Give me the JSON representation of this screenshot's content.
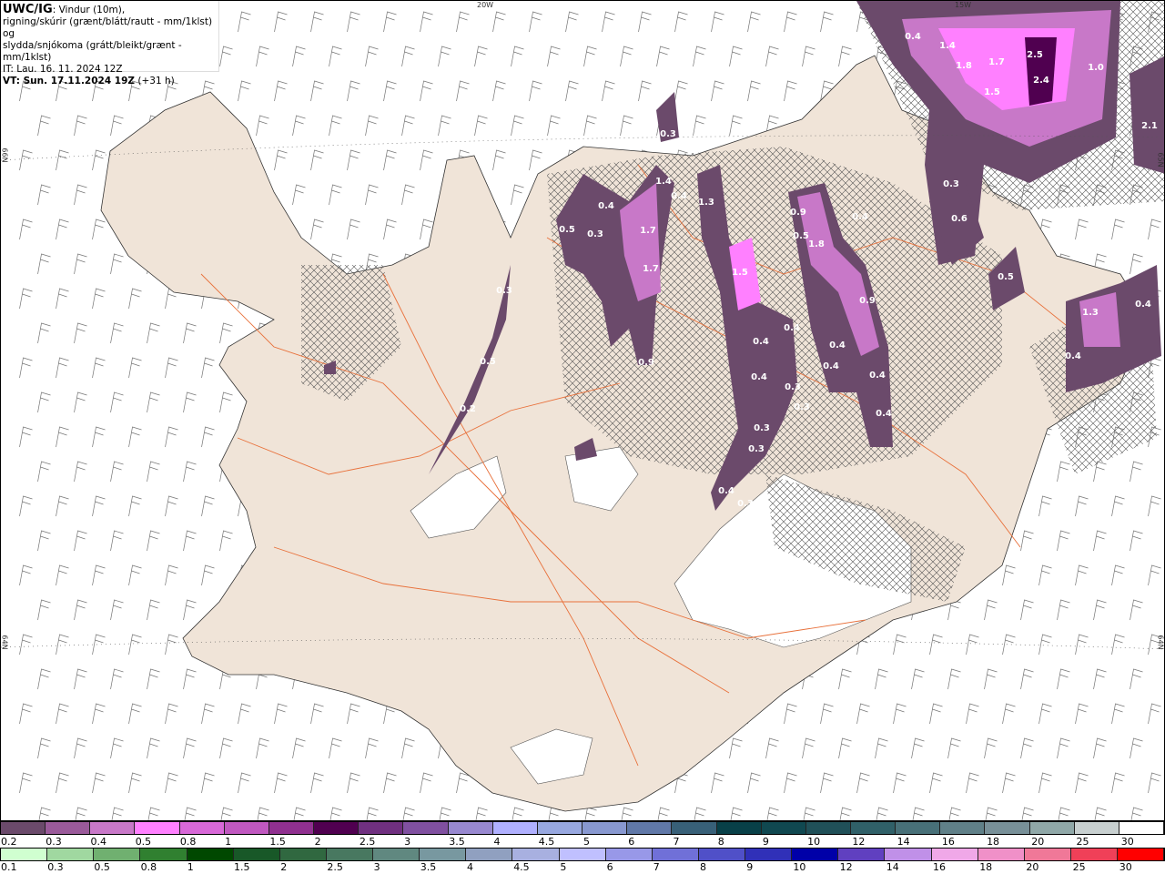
{
  "header": {
    "model": "UWC/IG",
    "title_rest": ": Vindur (10m),",
    "line2": "rigning/skúrir (grænt/blátt/rautt - mm/1klst) og",
    "line3": "slydda/snjókoma (grátt/bleikt/grænt - mm/1klst)",
    "it": "IT: Lau. 16. 11. 2024 12Z",
    "vt": "VT: Sun. 17.11.2024 19Z",
    "lead": " (+31 h)"
  },
  "axis_labels": {
    "top_left": "20W",
    "top_right": "15W",
    "left_upper": "66N",
    "left_lower": "64N",
    "right_upper": "65N",
    "right_lower": "64N"
  },
  "map_values": [
    "0.4",
    "1.4",
    "1.8",
    "1.7",
    "2.5",
    "2.4",
    "1.5",
    "1.0",
    "2.1",
    "0.3",
    "0.4",
    "1.4",
    "0.4",
    "1.3",
    "0.5",
    "1.7",
    "0.3",
    "1.7",
    "0.9",
    "0.5",
    "1.8",
    "0.4",
    "0.6",
    "0.3",
    "0.5",
    "1.5",
    "0.3",
    "0.9",
    "1.3",
    "0.4",
    "0.4",
    "0.4",
    "0.4",
    "0.4",
    "0.4",
    "0.4",
    "0.4",
    "0.3",
    "0.3",
    "0.4",
    "0.9",
    "0.5",
    "0.3",
    "0.3",
    "0.4",
    "0.3",
    "0.2"
  ],
  "colors": {
    "land": "#f0e4d8",
    "roads": "#e8703a",
    "sea": "#ffffff",
    "snow_light": "#6b4a6b",
    "snow_mid": "#c878c8",
    "snow_peak": "#ff80ff"
  },
  "legend_snow": {
    "labels": [
      "0.2",
      "0.3",
      "0.4",
      "0.5",
      "0.8",
      "1",
      "1.5",
      "2",
      "2.5",
      "3",
      "3.5",
      "4",
      "4.5",
      "5",
      "6",
      "7",
      "8",
      "9",
      "10",
      "12",
      "14",
      "16",
      "18",
      "20",
      "25",
      "30"
    ],
    "colors": [
      "#6b4a6b",
      "#9a5a9a",
      "#c878c8",
      "#ff80ff",
      "#d868d8",
      "#c058c0",
      "#903090",
      "#500050",
      "#703080",
      "#8050a0",
      "#9888d0",
      "#b0b0ff",
      "#98a8e0",
      "#8898d0",
      "#6078a8",
      "#386078",
      "#084048",
      "#104850",
      "#205058",
      "#306068",
      "#487078",
      "#608088",
      "#789098",
      "#90a8a8",
      "#c8d0d0",
      "#ffffff"
    ]
  },
  "legend_rain": {
    "labels": [
      "0.1",
      "0.3",
      "0.5",
      "0.8",
      "1",
      "1.5",
      "2",
      "2.5",
      "3",
      "3.5",
      "4",
      "4.5",
      "5",
      "6",
      "7",
      "8",
      "9",
      "10",
      "12",
      "14",
      "16",
      "18",
      "20",
      "25",
      "30"
    ],
    "colors": [
      "#d0ffd0",
      "#a0d8a0",
      "#70b070",
      "#308030",
      "#004800",
      "#185828",
      "#306840",
      "#487860",
      "#608880",
      "#7898a0",
      "#90a0c0",
      "#a8b0e0",
      "#c0c0ff",
      "#9898e8",
      "#7070d8",
      "#5050c8",
      "#3030b8",
      "#0000a8",
      "#6040c0",
      "#c090e8",
      "#f0a8e8",
      "#f090c8",
      "#f07898",
      "#f04058",
      "#ff0000"
    ]
  }
}
